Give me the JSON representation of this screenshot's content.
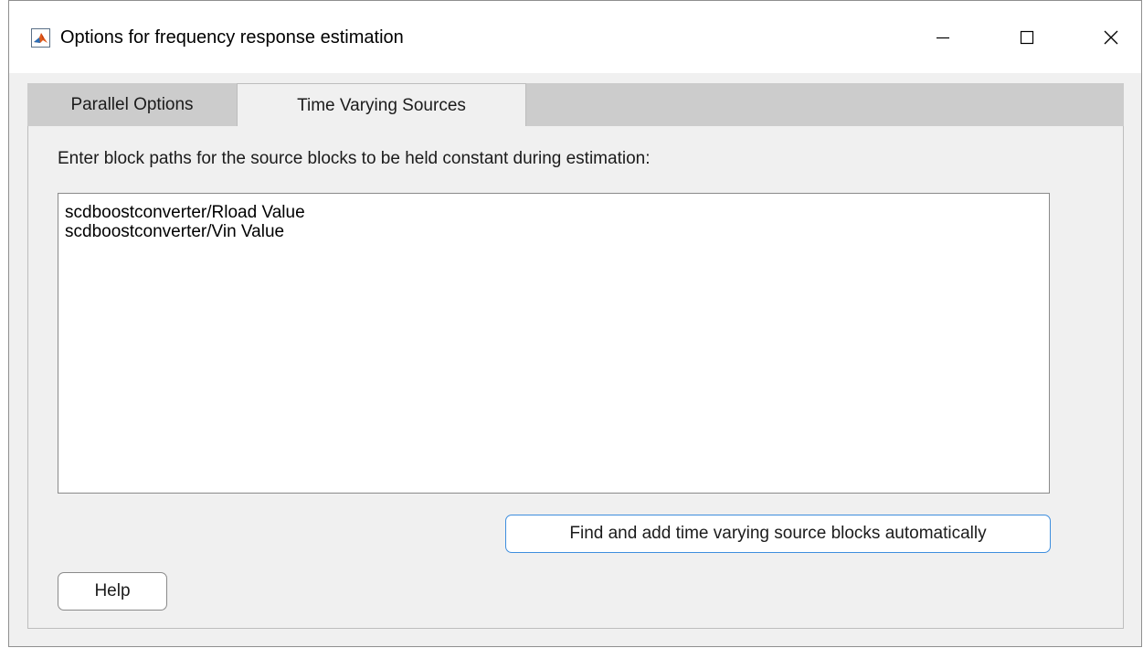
{
  "window": {
    "title": "Options for frequency response estimation",
    "app_icon": "matlab-icon",
    "controls": {
      "minimize_icon": "minimize-icon",
      "maximize_icon": "maximize-icon",
      "close_icon": "close-icon"
    }
  },
  "tabs": [
    {
      "label": "Parallel Options",
      "selected": false
    },
    {
      "label": "Time Varying Sources",
      "selected": true
    }
  ],
  "panel": {
    "instruction": "Enter block paths for the source blocks to be held constant during estimation:",
    "block_paths": [
      "scdboostconverter/Rload Value",
      "scdboostconverter/Vin Value"
    ],
    "auto_button_label": "Find and add time varying source blocks automatically",
    "help_button_label": "Help"
  },
  "colors": {
    "accent_focus": "#3e8ede",
    "window_bg": "#f0f0f0",
    "tabstrip_bg": "#cccccc"
  }
}
